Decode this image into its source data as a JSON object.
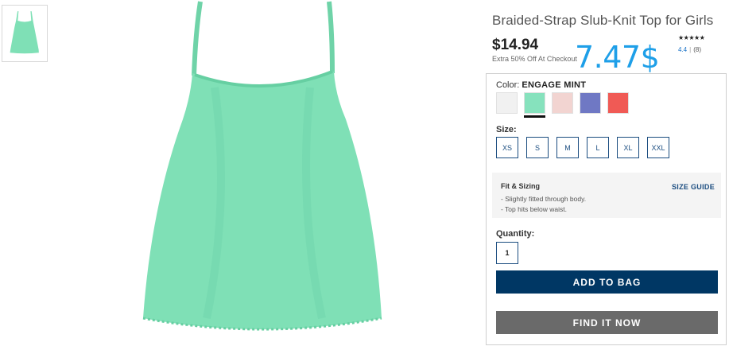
{
  "product": {
    "title": "Braided-Strap Slub-Knit Top for Girls",
    "price": "$14.94",
    "price_note": "Extra 50% Off At Checkout",
    "overlay_price": "7.47$",
    "rating": {
      "stars_glyphs": "★★★★★",
      "score": "4.4",
      "separator": "|",
      "count": "(8)"
    },
    "image_color": "#7fe0b6",
    "image_color_shade": "#66cfa2"
  },
  "color": {
    "label": "Color:",
    "selected": "ENGAGE MINT",
    "swatches": [
      {
        "name": "white",
        "hex": "#f1f1f1"
      },
      {
        "name": "engage-mint",
        "hex": "#86e2bd"
      },
      {
        "name": "pink",
        "hex": "#f2d4d1"
      },
      {
        "name": "periwinkle",
        "hex": "#6f78c4"
      },
      {
        "name": "coral",
        "hex": "#f05a55"
      }
    ]
  },
  "size": {
    "label": "Size:",
    "options": [
      "XS",
      "S",
      "M",
      "L",
      "XL",
      "XXL"
    ]
  },
  "fit": {
    "title": "Fit & Sizing",
    "size_guide": "SIZE GUIDE",
    "items": [
      "- Slightly fitted through body.",
      "- Top hits below waist."
    ]
  },
  "quantity": {
    "label": "Quantity:",
    "value": "1"
  },
  "actions": {
    "add_to_bag": "ADD TO BAG",
    "find_it_now": "FIND IT NOW"
  },
  "colors": {
    "accent": "#003764",
    "link": "#1b4d80",
    "overlay": "#1e9fe8",
    "secondary_button": "#6a6a6a"
  }
}
